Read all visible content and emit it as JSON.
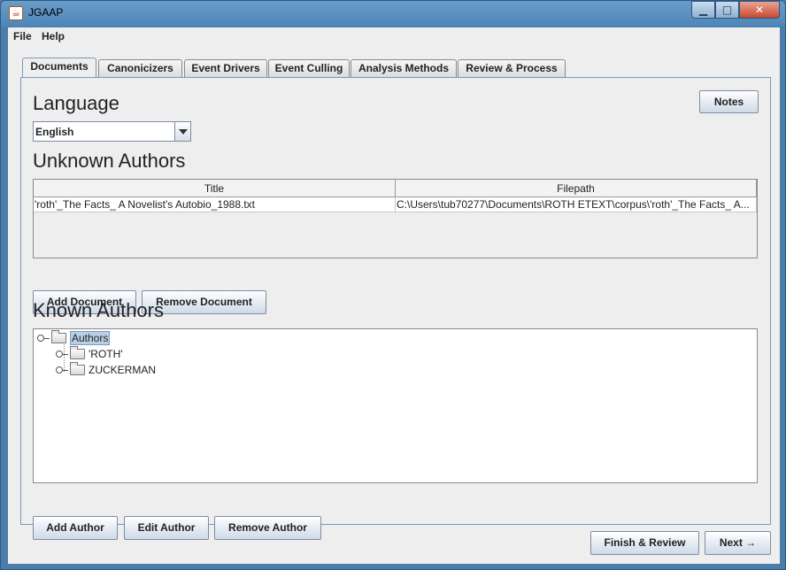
{
  "window": {
    "title": "JGAAP"
  },
  "menubar": {
    "file": "File",
    "help": "Help"
  },
  "tabs": [
    {
      "label": "Documents",
      "active": true
    },
    {
      "label": "Canonicizers"
    },
    {
      "label": "Event Drivers"
    },
    {
      "label": "Event Culling"
    },
    {
      "label": "Analysis Methods"
    },
    {
      "label": "Review & Process"
    }
  ],
  "documents": {
    "language_heading": "Language",
    "notes_label": "Notes",
    "language_value": "English",
    "unknown_heading": "Unknown Authors",
    "table": {
      "columns": [
        "Title",
        "Filepath"
      ],
      "rows": [
        [
          "'roth'_The Facts_ A Novelist's Autobio_1988.txt",
          "C:\\Users\\tub70277\\Documents\\ROTH ETEXT\\corpus\\'roth'_The Facts_ A..."
        ]
      ]
    },
    "add_document": "Add Document",
    "remove_document": "Remove Document",
    "known_heading": "Known Authors",
    "tree": {
      "root": "Authors",
      "children": [
        "'ROTH'",
        "ZUCKERMAN"
      ]
    },
    "add_author": "Add Author",
    "edit_author": "Edit Author",
    "remove_author": "Remove Author"
  },
  "footer": {
    "finish_review": "Finish & Review",
    "next": "Next →"
  }
}
